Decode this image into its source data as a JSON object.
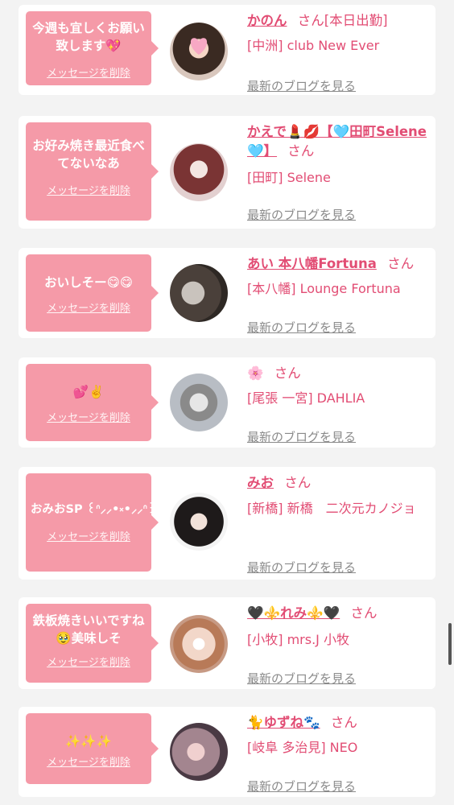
{
  "entries": [
    {
      "message": "今週も宜しくお願い致します💖",
      "delete_label": "メッセージを削除",
      "name": "かのん",
      "name_suffix": "[本日出勤]",
      "san": "さん",
      "shop": "[中洲] club New Ever",
      "blog_label": "最新のブログを見る"
    },
    {
      "message": "お好み焼き最近食べてないなあ",
      "delete_label": "メッセージを削除",
      "name": "かえで💄💋【🩵田町Selene🩵】",
      "name_suffix": "",
      "san": "さん",
      "shop": "[田町] Selene",
      "blog_label": "最新のブログを見る"
    },
    {
      "message": "おいしそー😋😋",
      "delete_label": "メッセージを削除",
      "name": "あい 本八幡Fortuna",
      "name_suffix": "",
      "san": "さん",
      "shop": "[本八幡] Lounge Fortuna",
      "blog_label": "最新のブログを見る"
    },
    {
      "message": "💕✌️",
      "delete_label": "メッセージを削除",
      "name": "🌸",
      "name_suffix": "",
      "san": "さん",
      "shop": "[尾張 一宮] DAHLIA",
      "blog_label": "最新のブログを見る"
    },
    {
      "message": "おみおSP ꒰ᐢ⸝⸝•༝•⸝⸝ᐢ꒱",
      "delete_label": "メッセージを削除",
      "name": "みお",
      "name_suffix": "",
      "san": "さん",
      "shop": "[新橋] 新橋　二次元カノジョ",
      "blog_label": "最新のブログを見る"
    },
    {
      "message": "鉄板焼きいいですね🥹美味しそ",
      "delete_label": "メッセージを削除",
      "name": "🖤⚜️れみ⚜️🖤",
      "name_suffix": "",
      "san": "さん",
      "shop": "[小牧] mrs.J 小牧",
      "blog_label": "最新のブログを見る"
    },
    {
      "message": "✨✨✨",
      "delete_label": "メッセージを削除",
      "name": "🐈ゆずね🐾",
      "name_suffix": "",
      "san": "さん",
      "shop": "[岐阜 多治見] NEO",
      "blog_label": "最新のブログを見る"
    }
  ],
  "colors": {
    "accent": "#e24d74",
    "bubble": "#f59aa8",
    "link_gray": "#8a8a8a"
  }
}
